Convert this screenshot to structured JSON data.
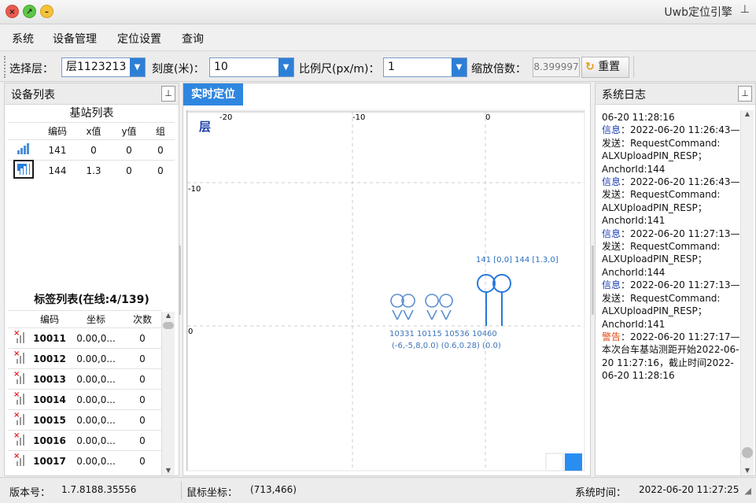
{
  "window": {
    "title": "Uwb定位引擎"
  },
  "menu": [
    "系统",
    "设备管理",
    "定位设置",
    "查询"
  ],
  "toolbar": {
    "floor_label": "选择层：",
    "floor_value": "层1123213",
    "scale_label": "刻度(米)：",
    "scale_value": "10",
    "ratio_label": "比例尺(px/m)：",
    "ratio_value": "1",
    "zoom_label": "缩放倍数：",
    "zoom_value": "8.399997",
    "reset_label": "重置"
  },
  "device_panel": {
    "title": "设备列表",
    "anchor_title": "基站列表",
    "anchor_headers": [
      "编码",
      "x值",
      "y值",
      "组"
    ],
    "anchors": [
      {
        "code": "141",
        "x": "0",
        "y": "0",
        "group": "0"
      },
      {
        "code": "144",
        "x": "1.3",
        "y": "0",
        "group": "0"
      }
    ],
    "tag_title": "标签列表(在线:4/139)",
    "tag_headers": [
      "编码",
      "坐标",
      "次数"
    ],
    "tags": [
      {
        "code": "10011",
        "coord": "0.00,0...",
        "count": "0"
      },
      {
        "code": "10012",
        "coord": "0.00,0...",
        "count": "0"
      },
      {
        "code": "10013",
        "coord": "0.00,0...",
        "count": "0"
      },
      {
        "code": "10014",
        "coord": "0.00,0...",
        "count": "0"
      },
      {
        "code": "10015",
        "coord": "0.00,0...",
        "count": "0"
      },
      {
        "code": "10016",
        "coord": "0.00,0...",
        "count": "0"
      },
      {
        "code": "10017",
        "coord": "0.00,0...",
        "count": "0"
      }
    ]
  },
  "map": {
    "tab": "实时定位",
    "floor_mark": "层",
    "x_ticks": [
      "-20",
      "-10",
      "0"
    ],
    "y_ticks": [
      "-10",
      "0"
    ],
    "anchor_label": "141 [0,0] 144 [1.3,0]",
    "tag_label": "10331 10115 10536 10460",
    "tag_coord_label": "(-6,-5,8,0.0) (0.6,0.28) (0.0)"
  },
  "log_panel": {
    "title": "系统日志",
    "entries": [
      {
        "kind": "text",
        "text": "06-20 11:28:16"
      },
      {
        "kind": "info",
        "label": "信息",
        "text": "：2022-06-20 11:26:43—"
      },
      {
        "kind": "text",
        "text": "发送：RequestCommand: ALXUploadPIN_RESP； AnchorId:144"
      },
      {
        "kind": "info",
        "label": "信息",
        "text": "：2022-06-20 11:26:43—"
      },
      {
        "kind": "text",
        "text": "发送：RequestCommand: ALXUploadPIN_RESP； AnchorId:141"
      },
      {
        "kind": "info",
        "label": "信息",
        "text": "：2022-06-20 11:27:13—"
      },
      {
        "kind": "text",
        "text": "发送：RequestCommand: ALXUploadPIN_RESP； AnchorId:144"
      },
      {
        "kind": "info",
        "label": "信息",
        "text": "：2022-06-20 11:27:13—"
      },
      {
        "kind": "text",
        "text": "发送：RequestCommand: ALXUploadPIN_RESP； AnchorId:141"
      },
      {
        "kind": "warn",
        "label": "警告",
        "text": "：2022-06-20 11:27:17—"
      },
      {
        "kind": "text",
        "text": "本次台车基站测距开始2022-06-20 11:27:16，截止时间2022-06-20 11:28:16"
      }
    ]
  },
  "status": {
    "version_label": "版本号：",
    "version": "1.7.8188.35556",
    "mouse_label": "鼠标坐标：",
    "mouse": "(713,466)",
    "time_label": "系统时间：",
    "time": "2022-06-20 11:27:25"
  }
}
